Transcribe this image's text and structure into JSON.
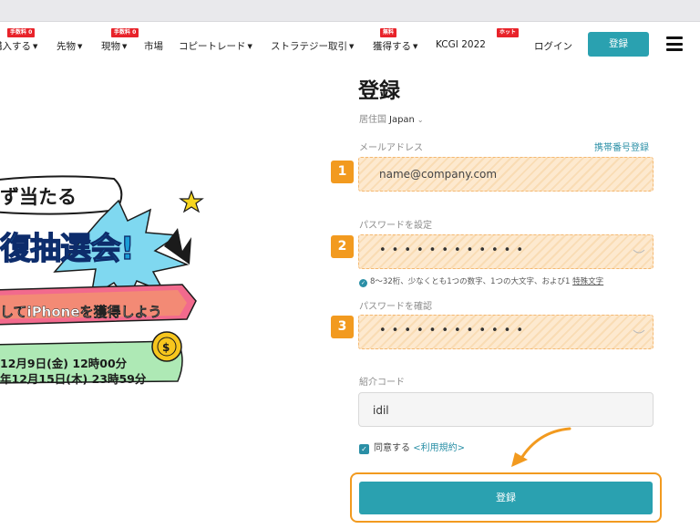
{
  "nav": {
    "items": [
      {
        "label": "購入する",
        "badge": "手数料 0",
        "dropdown": true
      },
      {
        "label": "先物",
        "badge": "",
        "dropdown": true
      },
      {
        "label": "現物",
        "badge": "手数料 0",
        "dropdown": true
      },
      {
        "label": "市場",
        "badge": "",
        "dropdown": false
      },
      {
        "label": "コピートレード",
        "badge": "",
        "dropdown": true
      },
      {
        "label": "ストラテジー取引",
        "badge": "",
        "dropdown": true
      },
      {
        "label": "獲得する",
        "badge": "無料",
        "dropdown": true
      },
      {
        "label": "KCGI 2022",
        "badge": "",
        "dropdown": false
      },
      {
        "label": "",
        "badge": "ホット",
        "dropdown": false
      }
    ],
    "login": "ログイン",
    "register": "登録",
    "menu_icon": "hamburger-icon"
  },
  "promo": {
    "line1": "ず当たる",
    "line2": "復抽選会!",
    "line3": "してiPhoneを獲得しよう",
    "line4a": "12月9日(金) 12時00分",
    "line4b": "年12月15日(木) 23時59分",
    "colors": {
      "accent_blue": "#1a9dd6",
      "ribbon_pink": "#f26a8d",
      "yellow": "#f7d51d",
      "green_band": "#9ee3a8"
    }
  },
  "form": {
    "title": "登録",
    "country_label": "居住国",
    "country_value": "Japan",
    "email_label": "メールアドレス",
    "phone_link": "携帯番号登録",
    "email_placeholder": "name@company.com",
    "password_label": "パスワードを設定",
    "password_dots": "••••••••••••",
    "password_hint": "8～32桁、少なくとも1つの数字、1つの大文字、および1",
    "password_hint_link": "特殊文字",
    "confirm_label": "パスワードを確認",
    "confirm_dots": "••••••••••••",
    "referral_label": "紹介コード",
    "referral_value": "idil",
    "agree_text": "同意する",
    "terms_link": "<利用規約>",
    "submit": "登録",
    "steps": [
      "1",
      "2",
      "3"
    ],
    "colors": {
      "accent": "#2aa1b0",
      "highlight": "#f29a1f",
      "link": "#2a8fa6"
    }
  }
}
